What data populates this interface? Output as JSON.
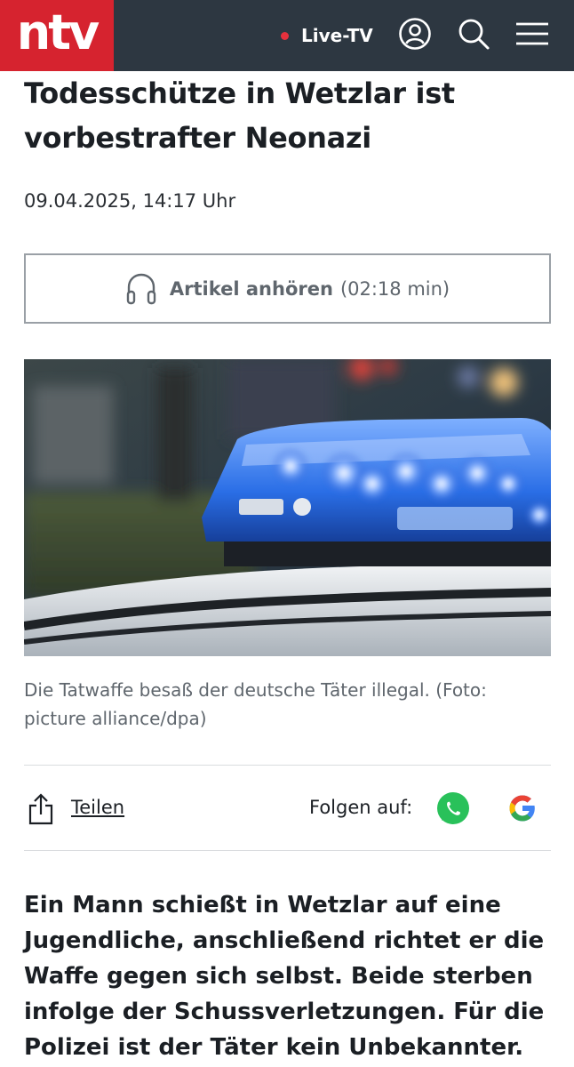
{
  "header": {
    "logo": "ntv",
    "live_label": "Live-TV",
    "icons": [
      "user-icon",
      "search-icon",
      "menu-icon"
    ],
    "colors": {
      "bar": "#2d3741",
      "brand": "#d6232f",
      "live_dot": "#e5313d"
    }
  },
  "article": {
    "headline": "Todesschütze in Wetzlar ist vorbestrafter Neonazi",
    "date": "09.04.2025, 14:17 Uhr",
    "listen": {
      "label": "Artikel anhören",
      "duration": "(02:18 min)",
      "icon": "headphones-icon"
    },
    "image": {
      "caption": "Die Tatwaffe besaß der deutsche Täter illegal. (Foto: picture alliance/dpa)"
    },
    "share": {
      "label": "Teilen",
      "icon": "share-icon"
    },
    "follow": {
      "label": "Folgen auf:",
      "icons": [
        "whatsapp-icon",
        "google-icon"
      ]
    },
    "lead": "Ein Mann schießt in Wetzlar auf eine Jugendliche, anschließend richtet er die Waffe gegen sich selbst. Beide sterben infolge der Schussverletzungen. Für die Polizei ist der Täter kein Unbekannter."
  }
}
